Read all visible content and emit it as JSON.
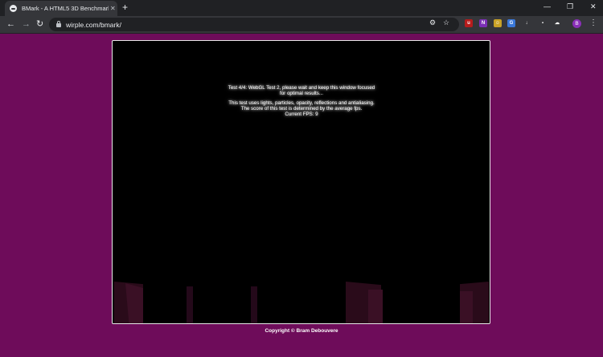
{
  "browser": {
    "tab_title": "BMark - A HTML5 3D Benchmark",
    "tab_close": "✕",
    "new_tab": "+",
    "url": "wirple.com/bmark/",
    "nav": {
      "back": "←",
      "forward": "→",
      "reload": "↻"
    },
    "window_controls": {
      "minimize": "—",
      "restore": "❐",
      "close": "✕"
    },
    "profile_initial": "B",
    "menu": "⋮",
    "extensions": [
      {
        "name": "ublock-icon",
        "label": "u",
        "color": "#b71c1c"
      },
      {
        "name": "onenote-icon",
        "label": "N",
        "color": "#7b2fb5"
      },
      {
        "name": "extension-face-icon",
        "label": "☺",
        "color": "#c9a227"
      },
      {
        "name": "translate-icon",
        "label": "G",
        "color": "#3a78d8"
      },
      {
        "name": "download-icon",
        "label": "↓",
        "color": "#35363a"
      },
      {
        "name": "chat-icon",
        "label": "▪",
        "color": "#35363a"
      },
      {
        "name": "cloud-icon",
        "label": "☁",
        "color": "#35363a"
      }
    ]
  },
  "benchmark": {
    "status_line1": "Test 4/4: WebGL Test 2, please wait and keep this window focused for optimal results...",
    "status_line2": "This test uses lights, particles, opacity, reflections and antialiasing. The score of this test is determined by the average fps.",
    "fps_label": "Current FPS: 9"
  },
  "footer": {
    "copyright": "Copyright © Bram Debouvere"
  },
  "colors": {
    "page_background": "#6e0c5a",
    "stage_background": "#000000"
  }
}
